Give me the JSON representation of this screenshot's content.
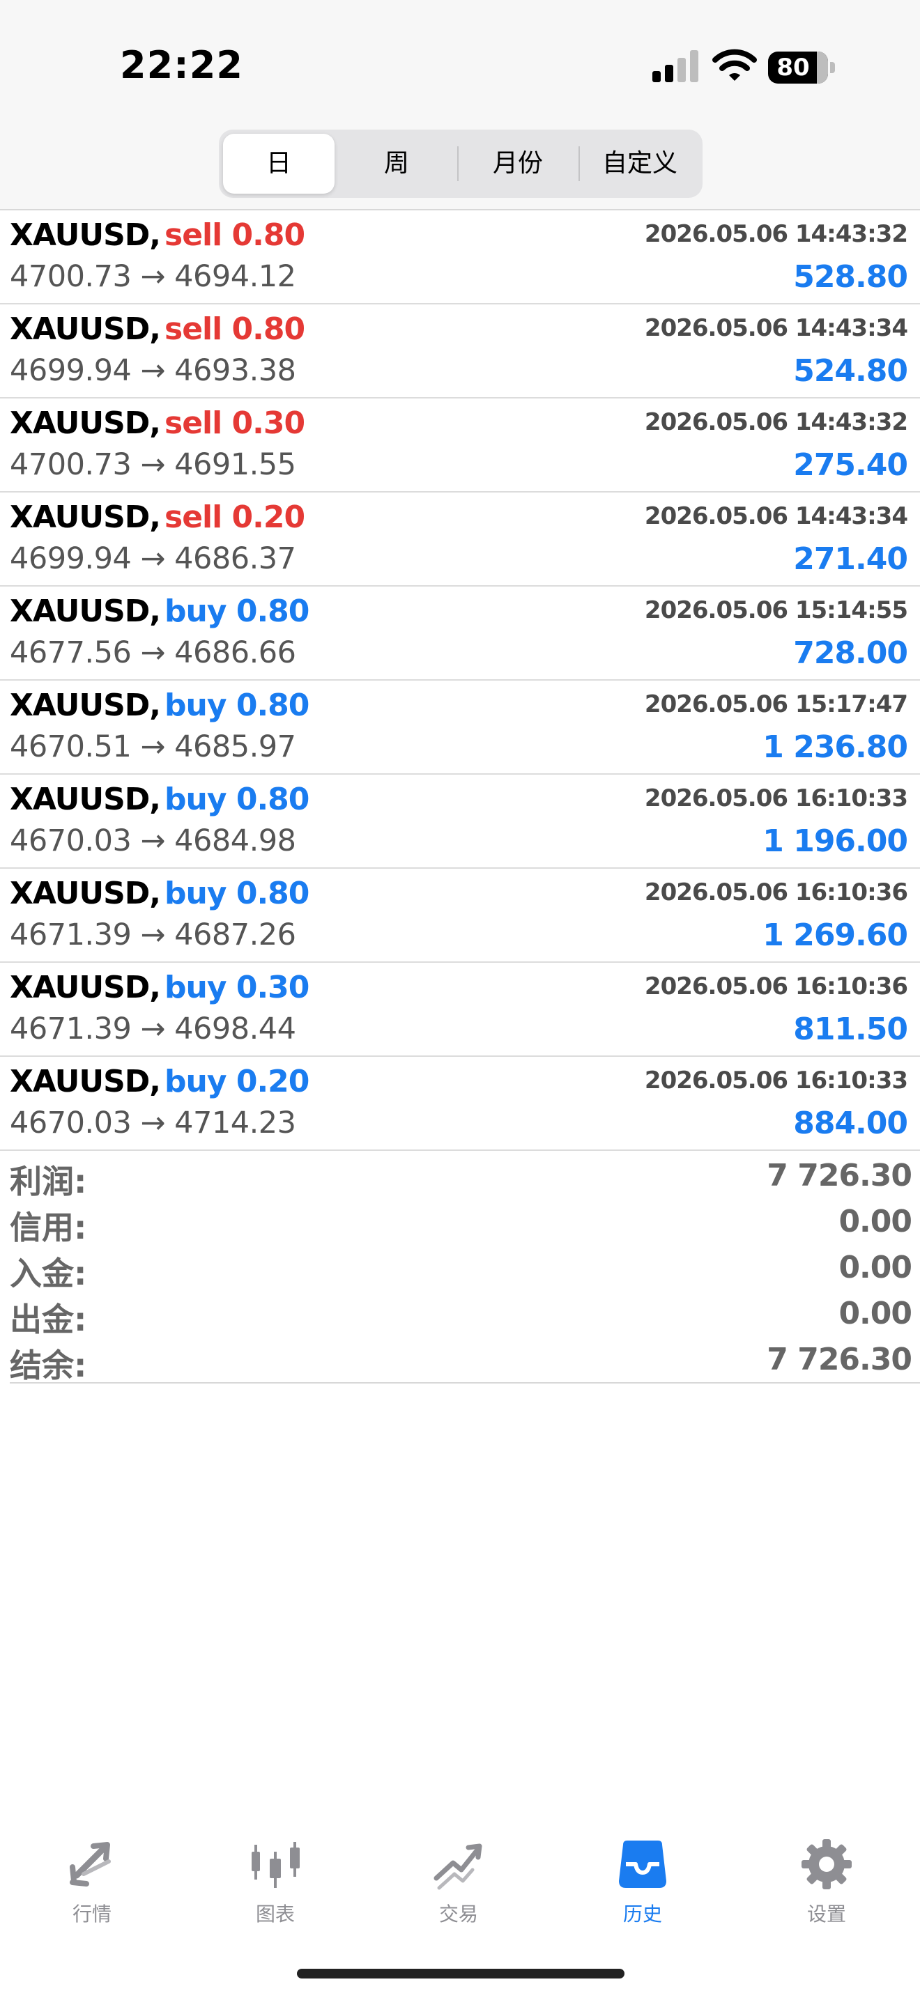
{
  "status_bar": {
    "time": "22:22",
    "battery": "80",
    "icons": [
      "signal-icon",
      "wifi-icon",
      "battery-icon"
    ]
  },
  "period_tabs": [
    {
      "label": "日",
      "selected": true
    },
    {
      "label": "周",
      "selected": false
    },
    {
      "label": "月份",
      "selected": false
    },
    {
      "label": "自定义",
      "selected": false
    }
  ],
  "trades": [
    {
      "symbol": "XAUUSD,",
      "direction": "sell",
      "lots": "sell 0.80",
      "time": "2026.05.06 14:43:32",
      "prices": "4700.73 → 4694.12",
      "profit": "528.80"
    },
    {
      "symbol": "XAUUSD,",
      "direction": "sell",
      "lots": "sell 0.80",
      "time": "2026.05.06 14:43:34",
      "prices": "4699.94 → 4693.38",
      "profit": "524.80"
    },
    {
      "symbol": "XAUUSD,",
      "direction": "sell",
      "lots": "sell 0.30",
      "time": "2026.05.06 14:43:32",
      "prices": "4700.73 → 4691.55",
      "profit": "275.40"
    },
    {
      "symbol": "XAUUSD,",
      "direction": "sell",
      "lots": "sell 0.20",
      "time": "2026.05.06 14:43:34",
      "prices": "4699.94 → 4686.37",
      "profit": "271.40"
    },
    {
      "symbol": "XAUUSD,",
      "direction": "buy",
      "lots": "buy 0.80",
      "time": "2026.05.06 15:14:55",
      "prices": "4677.56 → 4686.66",
      "profit": "728.00"
    },
    {
      "symbol": "XAUUSD,",
      "direction": "buy",
      "lots": "buy 0.80",
      "time": "2026.05.06 15:17:47",
      "prices": "4670.51 → 4685.97",
      "profit": "1 236.80"
    },
    {
      "symbol": "XAUUSD,",
      "direction": "buy",
      "lots": "buy 0.80",
      "time": "2026.05.06 16:10:33",
      "prices": "4670.03 → 4684.98",
      "profit": "1 196.00"
    },
    {
      "symbol": "XAUUSD,",
      "direction": "buy",
      "lots": "buy 0.80",
      "time": "2026.05.06 16:10:36",
      "prices": "4671.39 → 4687.26",
      "profit": "1 269.60"
    },
    {
      "symbol": "XAUUSD,",
      "direction": "buy",
      "lots": "buy 0.30",
      "time": "2026.05.06 16:10:36",
      "prices": "4671.39 → 4698.44",
      "profit": "811.50"
    },
    {
      "symbol": "XAUUSD,",
      "direction": "buy",
      "lots": "buy 0.20",
      "time": "2026.05.06 16:10:33",
      "prices": "4670.03 → 4714.23",
      "profit": "884.00"
    }
  ],
  "summary": [
    {
      "label": "利润:",
      "value": "7 726.30"
    },
    {
      "label": "信用:",
      "value": "0.00"
    },
    {
      "label": "入金:",
      "value": "0.00"
    },
    {
      "label": "出金:",
      "value": "0.00"
    },
    {
      "label": "结余:",
      "value": "7 726.30"
    }
  ],
  "tab_bar": [
    {
      "label": "行情",
      "icon": "quotes-arrows-icon",
      "active": false
    },
    {
      "label": "图表",
      "icon": "candlestick-chart-icon",
      "active": false
    },
    {
      "label": "交易",
      "icon": "trade-trend-icon",
      "active": false
    },
    {
      "label": "历史",
      "icon": "history-inbox-icon",
      "active": true
    },
    {
      "label": "设置",
      "icon": "gear-icon",
      "active": false
    }
  ],
  "colors": {
    "sell": "#e53935",
    "buy": "#1a7cf0",
    "profit": "#1a7cf0",
    "tab_active": "#1a7cf0",
    "tab_inactive": "#8e8e93"
  }
}
